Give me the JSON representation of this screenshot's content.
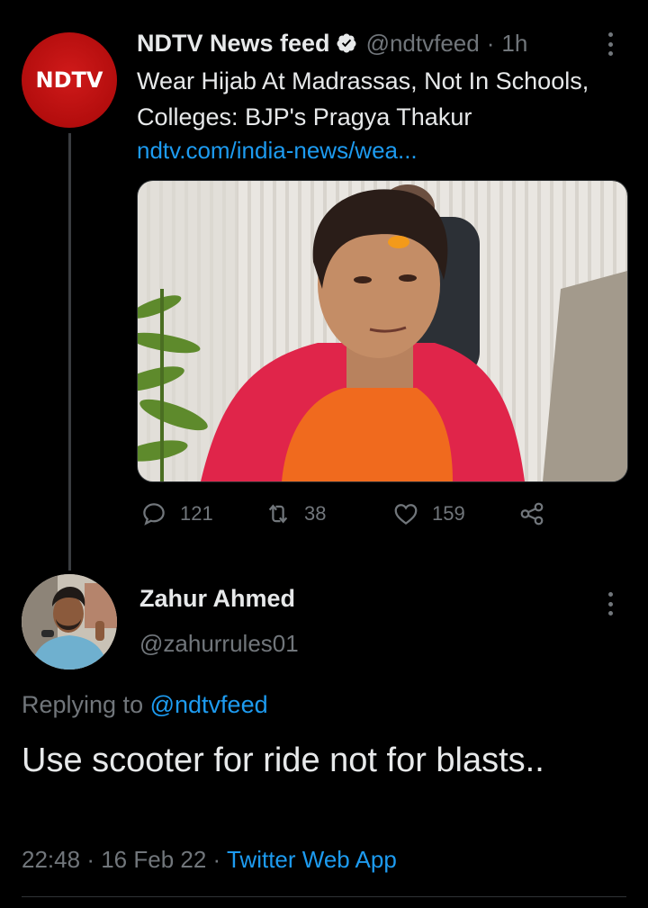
{
  "parent_tweet": {
    "avatar_logo": "NDTV",
    "display_name": "NDTV News feed",
    "verified_icon": "verified-badge-icon",
    "handle": "@ndtvfeed",
    "separator": "·",
    "time": "1h",
    "text": "Wear Hijab At Madrassas, Not In Schools, Colleges: BJP's Pragya Thakur",
    "link": "ndtv.com/india-news/wea...",
    "media_description_icon": "news-photo",
    "stats": {
      "replies": "121",
      "retweets": "38",
      "likes": "159"
    }
  },
  "reply_tweet": {
    "display_name": "Zahur Ahmed",
    "handle": "@zahurrules01",
    "replying_to_label": "Replying to",
    "replying_to_handle": "@ndtvfeed",
    "text": "Use scooter for ride not for blasts..",
    "time": "22:48",
    "separator": "·",
    "date": "16 Feb 22",
    "separator2": "·",
    "source": "Twitter Web App"
  },
  "colors": {
    "background": "#000000",
    "text": "#e7e9ea",
    "secondary": "#71767b",
    "accent": "#1d9bf0",
    "ndtv_red": "#b30d0d"
  }
}
